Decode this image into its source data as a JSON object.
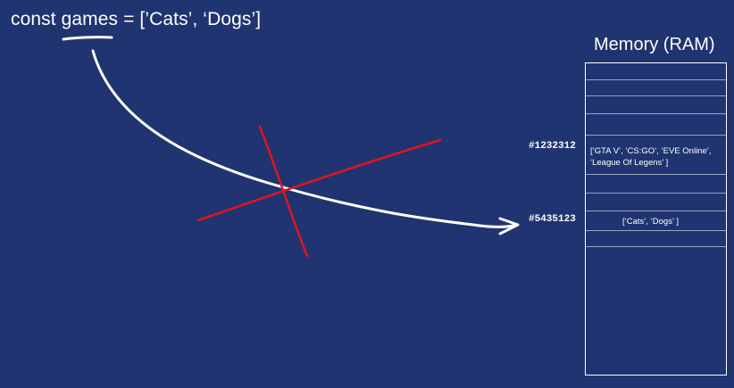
{
  "code": {
    "statement": "const games = [’Cats’, ‘Dogs’]"
  },
  "memory": {
    "title": "Memory (RAM)",
    "entries": [
      {
        "address": "#1232312",
        "value_line1": "[‘GTA V’, ‘CS:GO’, ‘EVE Online’,",
        "value_line2": "‘League Of Legens’ ]"
      },
      {
        "address": "#5435123",
        "value_line1": "[‘Cats’, ‘Dogs’ ]"
      }
    ]
  },
  "colors": {
    "background": "#1f3470",
    "text": "#ffffff",
    "arrow": "#ffffff",
    "cross": "#e0141e"
  }
}
